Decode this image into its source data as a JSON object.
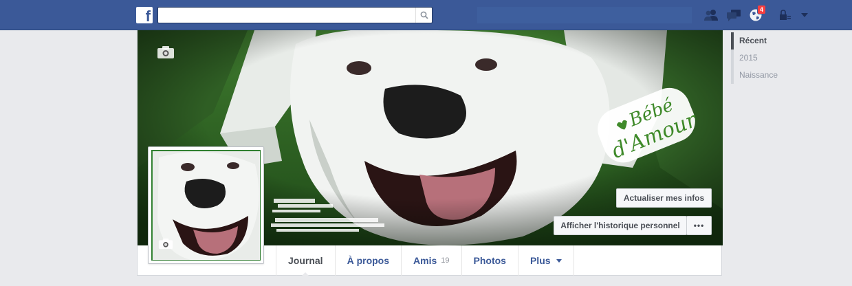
{
  "topbar": {
    "logo": "f",
    "search": {
      "value": "",
      "placeholder": ""
    },
    "icons": [
      "friend-requests-icon",
      "messages-icon",
      "notifications-globe-icon",
      "privacy-lock-icon",
      "account-menu-caret-icon"
    ],
    "notifications_count": "4",
    "brand_color": "#3b5998"
  },
  "cover": {
    "text_overlay_line1": "Bébé",
    "text_overlay_line2": "d'Amour",
    "update_info_button": "Actualiser mes infos",
    "activity_log_button": "Afficher l'historique personnel",
    "more_button": "•••"
  },
  "tabs": [
    {
      "label": "Journal"
    },
    {
      "label": "À propos"
    },
    {
      "label": "Amis",
      "count": "19"
    },
    {
      "label": "Photos"
    },
    {
      "label": "Plus"
    }
  ],
  "timeline_nav": [
    {
      "label": "Récent"
    },
    {
      "label": "2015"
    },
    {
      "label": "Naissance"
    }
  ]
}
